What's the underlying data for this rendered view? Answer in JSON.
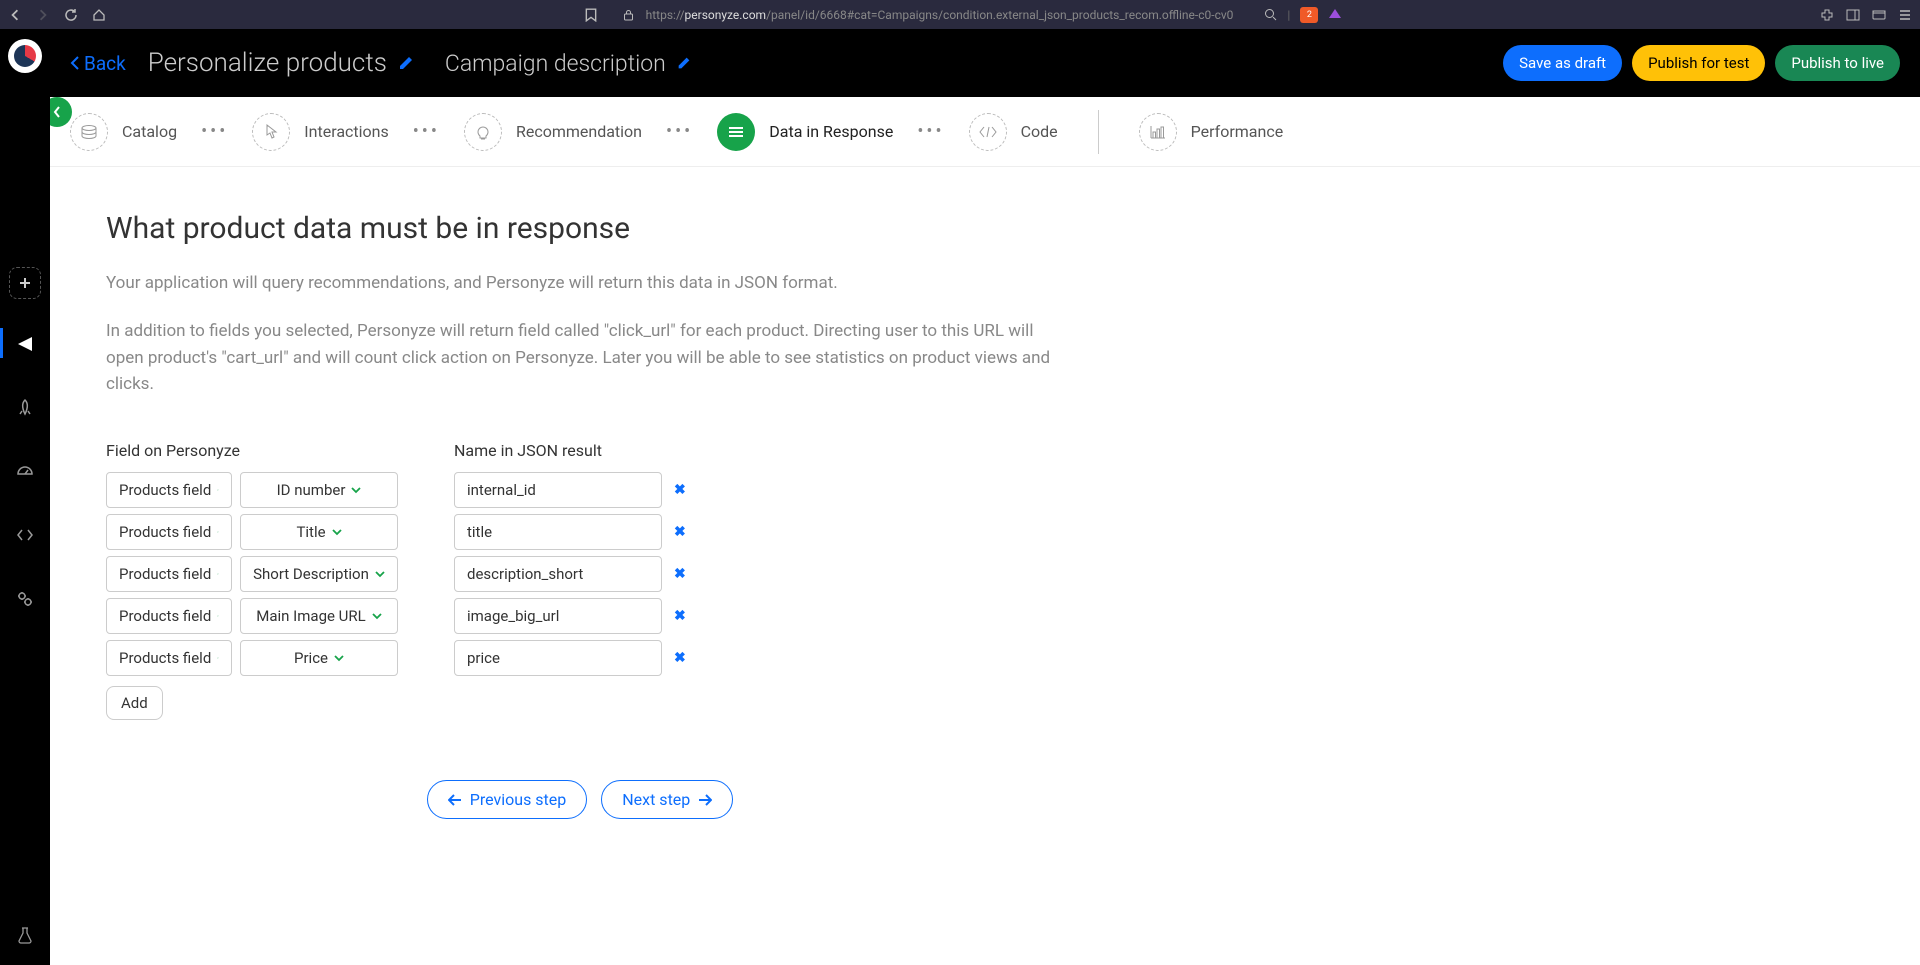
{
  "browser": {
    "url_prefix": "https://",
    "url_domain": "personyze.com",
    "url_path": "/panel/id/6668#cat=Campaigns/condition.external_json_products_recom.offline-c0-cv0",
    "shield_count": "2"
  },
  "header": {
    "back": "Back",
    "title": "Personalize products",
    "subtitle": "Campaign description",
    "actions": {
      "draft": "Save as draft",
      "test": "Publish for test",
      "live": "Publish to live"
    }
  },
  "steps": {
    "catalog": "Catalog",
    "interactions": "Interactions",
    "recommendation": "Recommendation",
    "data": "Data in Response",
    "code": "Code",
    "performance": "Performance"
  },
  "content": {
    "title": "What product data must be in response",
    "desc1": "Your application will query recommendations, and Personyze will return this data in JSON format.",
    "desc2": "In addition to fields you selected, Personyze will return field called \"click_url\" for each product. Directing user to this URL will open product's \"cart_url\" and will count click action on Personyze. Later you will be able to see statistics on product views and clicks.",
    "col1_header": "Field on Personyze",
    "col2_header": "Name in JSON result",
    "field_label": "Products field",
    "rows": [
      {
        "attr": "ID number",
        "json": "internal_id"
      },
      {
        "attr": "Title",
        "json": "title"
      },
      {
        "attr": "Short Description",
        "json": "description_short"
      },
      {
        "attr": "Main Image URL",
        "json": "image_big_url"
      },
      {
        "attr": "Price",
        "json": "price"
      }
    ],
    "add": "Add",
    "prev": "Previous step",
    "next": "Next step"
  }
}
